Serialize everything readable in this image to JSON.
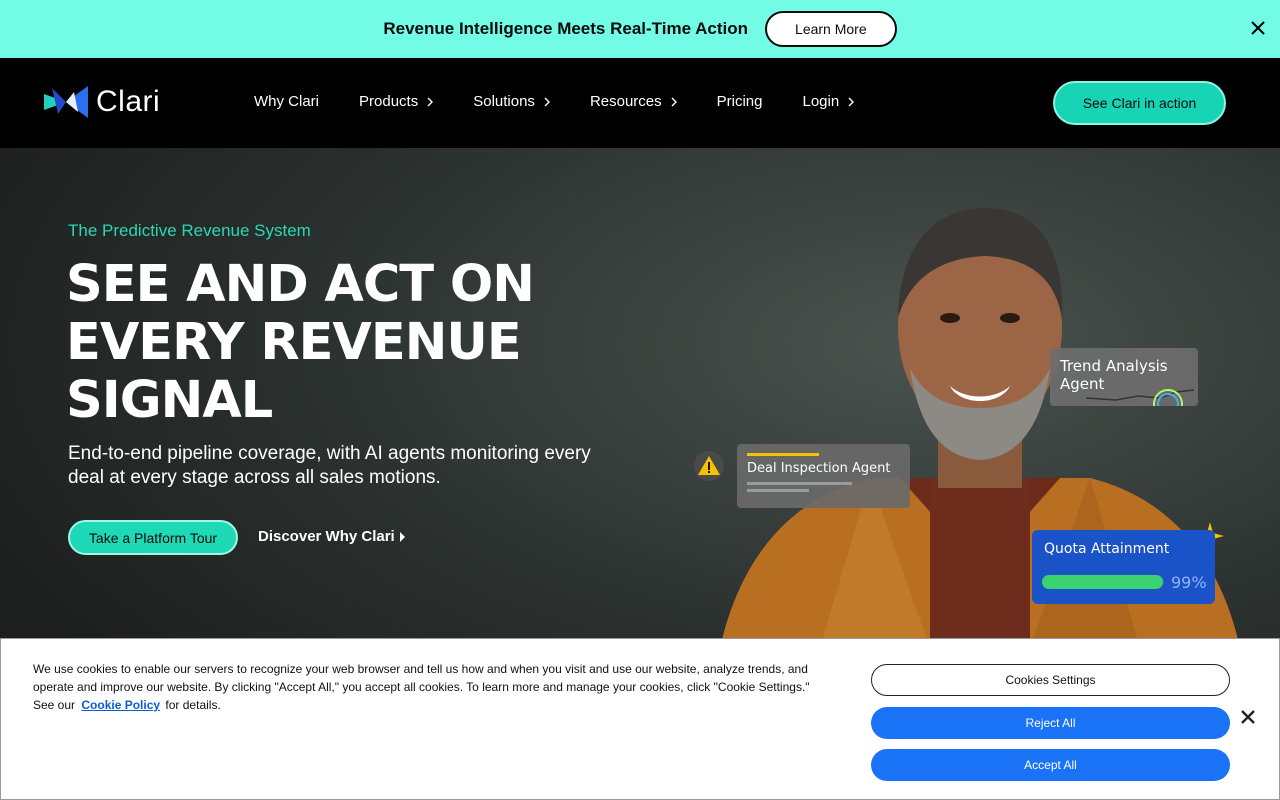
{
  "promo": {
    "text": "Revenue Intelligence Meets Real-Time Action",
    "button_label": "Learn More",
    "close_icon": "close-icon"
  },
  "nav": {
    "logo_text": "Clari",
    "items": [
      {
        "label": "Why Clari",
        "has_chevron": false
      },
      {
        "label": "Products",
        "has_chevron": true
      },
      {
        "label": "Solutions",
        "has_chevron": true
      },
      {
        "label": "Resources",
        "has_chevron": true
      },
      {
        "label": "Pricing",
        "has_chevron": false
      },
      {
        "label": "Login",
        "has_chevron": true
      }
    ],
    "cta_label": "See Clari in action"
  },
  "hero": {
    "eyebrow": "The Predictive Revenue System",
    "headline_lines": [
      "SEE AND ACT ON",
      "EVERY REVENUE",
      "SIGNAL"
    ],
    "subhead": "End-to-end pipeline coverage, with AI agents monitoring every deal at every stage across all sales motions.",
    "primary_button": "Take a Platform Tour",
    "secondary_link": "Discover Why Clari",
    "cards": {
      "trend": "Trend Analysis Agent",
      "deal": "Deal Inspection Agent",
      "quota_title": "Quota Attainment",
      "quota_value": "99%",
      "quota_fraction": 0.99
    }
  },
  "cookie": {
    "text_before": "We use cookies to enable our servers to recognize your web browser and tell us how and when you visit and use our website, analyze trends, and operate and improve our website. By clicking \"Accept All,\" you accept all cookies. To learn more and manage your cookies, click \"Cookie Settings.\" See our",
    "link_text": "Cookie Policy",
    "text_after": "for details.",
    "settings_label": "Cookies Settings",
    "reject_label": "Reject All",
    "accept_label": "Accept All"
  },
  "colors": {
    "promo_bg": "#72fbe5",
    "accent_teal": "#1dd9b5",
    "cookie_blue": "#1a73f6",
    "quota_card": "#1a52c7",
    "quota_fill": "#3ad36f"
  }
}
